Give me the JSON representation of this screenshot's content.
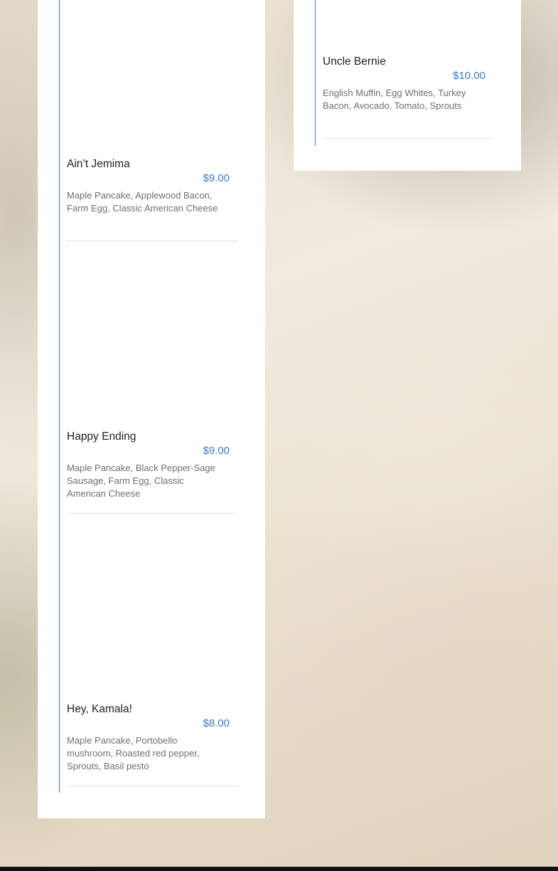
{
  "menu": {
    "left_column": [
      {
        "name": "Ain’t Jemima",
        "price": "$9.00",
        "description": "Maple Pancake, Applewood Bacon, Farm Egg, Classic American Cheese"
      },
      {
        "name": "Happy Ending",
        "price": "$9.00",
        "description": "Maple Pancake, Black Pepper-Sage Sausage, Farm Egg, Classic American Cheese"
      },
      {
        "name": "Hey, Kamala!",
        "price": "$8.00",
        "description": "Maple Pancake, Portobello mushroom, Roasted red pepper, Sprouts, Basil pesto"
      }
    ],
    "right_column": [
      {
        "name": "Uncle Bernie",
        "price": "$10.00",
        "description": "English Muffin, Egg Whites, Turkey Bacon, Avocado, Tomato, Sprouts"
      }
    ]
  },
  "colors": {
    "accent": "#3b7bc8",
    "text": "#1f1f1f",
    "muted_text": "#6f6f6f",
    "card_background": "#ffffff"
  }
}
